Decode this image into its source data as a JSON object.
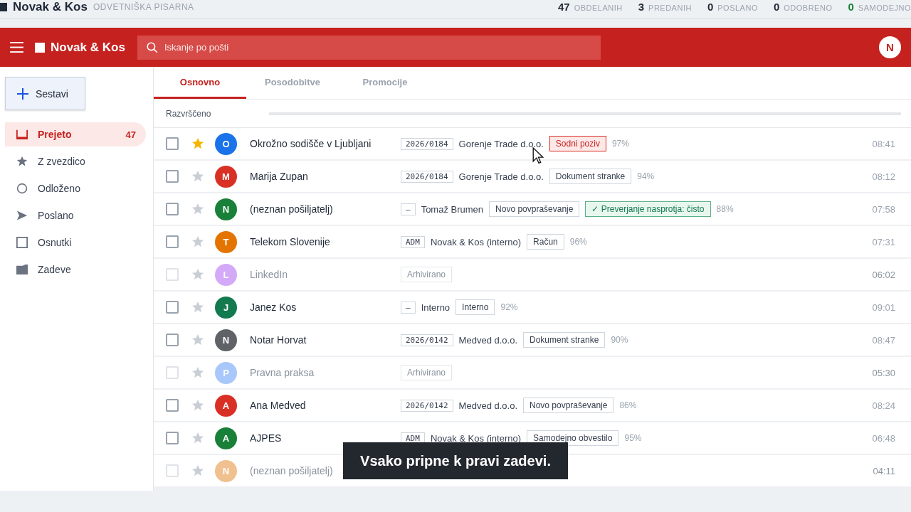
{
  "top_bar": {
    "brand": "Novak & Kos",
    "subtitle": "ODVETNIŠKA PISARNA",
    "stats": [
      {
        "value": "47",
        "label": "OBDELANIH",
        "color": "#1f2937"
      },
      {
        "value": "3",
        "label": "PREDANIH",
        "color": "#1f2937"
      },
      {
        "value": "0",
        "label": "POSLANO",
        "color": "#1f2937"
      },
      {
        "value": "0",
        "label": "ODOBRENO",
        "color": "#1f2937"
      },
      {
        "value": "0",
        "label": "SAMODEJNO",
        "color": "#188038"
      }
    ]
  },
  "header": {
    "title": "Novak & Kos",
    "search": {
      "placeholder": "Iskanje po pošti"
    },
    "avatar": "N"
  },
  "compose": "Sestavi",
  "sidebar": {
    "items": [
      {
        "kind": "inbox",
        "label": "Prejeto",
        "count": "47",
        "selected": true
      },
      {
        "kind": "star",
        "label": "Z zvezdico",
        "selected": false
      },
      {
        "kind": "clock",
        "label": "Odloženo",
        "selected": false
      },
      {
        "kind": "send",
        "label": "Poslano",
        "selected": false
      },
      {
        "kind": "draft",
        "label": "Osnutki",
        "selected": false
      },
      {
        "kind": "folder",
        "label": "Zadeve",
        "selected": false
      }
    ]
  },
  "tabs": [
    {
      "label": "Osnovno",
      "selected": true
    },
    {
      "label": "Posodobitve",
      "selected": false
    },
    {
      "label": "Promocije",
      "selected": false
    }
  ],
  "sort_label": "Razvrščeno",
  "rows": [
    {
      "initial": "O",
      "color": "#1a73e8",
      "sender": "Okrožno sodišče v Ljubljani",
      "starred": true,
      "archived": false,
      "ref": "2026/0184",
      "party": "Gorenje Trade d.o.o.",
      "tags": [
        {
          "text": "Sodni poziv",
          "kind": "alert"
        }
      ],
      "score": "97%",
      "time": "08:41"
    },
    {
      "initial": "M",
      "color": "#d93025",
      "sender": "Marija Zupan",
      "starred": false,
      "archived": false,
      "ref": "2026/0184",
      "party": "Gorenje Trade d.o.o.",
      "tags": [
        {
          "text": "Dokument stranke",
          "kind": "plain"
        }
      ],
      "score": "94%",
      "time": "08:12"
    },
    {
      "initial": "N",
      "color": "#188038",
      "sender": "(neznan pošiljatelj)",
      "starred": false,
      "archived": false,
      "ref": "–",
      "party": "Tomaž Brumen",
      "tags": [
        {
          "text": "Novo povpraševanje",
          "kind": "plain"
        },
        {
          "text": "✓ Preverjanje nasprotja: čisto",
          "kind": "check"
        }
      ],
      "score": "88%",
      "time": "07:58"
    },
    {
      "initial": "T",
      "color": "#e37400",
      "sender": "Telekom Slovenije",
      "starred": false,
      "archived": false,
      "ref": "ADM",
      "party": "Novak & Kos (interno)",
      "tags": [
        {
          "text": "Račun",
          "kind": "plain"
        }
      ],
      "score": "96%",
      "time": "07:31"
    },
    {
      "initial": "L",
      "color": "#d4a9f7",
      "sender": "LinkedIn",
      "starred": false,
      "archived": true,
      "tags": [
        {
          "text": "Arhivirano",
          "kind": "plain"
        }
      ],
      "time": "06:02"
    },
    {
      "initial": "J",
      "color": "#137a4f",
      "sender": "Janez Kos",
      "starred": false,
      "archived": false,
      "ref": "–",
      "party": "Interno",
      "tags": [
        {
          "text": "Interno",
          "kind": "plain"
        }
      ],
      "score": "92%",
      "time": "09:01"
    },
    {
      "initial": "N",
      "color": "#5f6368",
      "sender": "Notar Horvat",
      "starred": false,
      "archived": false,
      "ref": "2026/0142",
      "party": "Medved d.o.o.",
      "tags": [
        {
          "text": "Dokument stranke",
          "kind": "plain"
        }
      ],
      "score": "90%",
      "time": "08:47"
    },
    {
      "initial": "P",
      "color": "#a8c7fa",
      "sender": "Pravna praksa",
      "starred": false,
      "archived": true,
      "tags": [
        {
          "text": "Arhivirano",
          "kind": "plain"
        }
      ],
      "time": "05:30"
    },
    {
      "initial": "A",
      "color": "#d93025",
      "sender": "Ana Medved",
      "starred": false,
      "archived": false,
      "ref": "2026/0142",
      "party": "Medved d.o.o.",
      "tags": [
        {
          "text": "Novo povpraševanje",
          "kind": "plain"
        }
      ],
      "score": "86%",
      "time": "08:24"
    },
    {
      "initial": "A",
      "color": "#188038",
      "sender": "AJPES",
      "starred": false,
      "archived": false,
      "ref": "ADM",
      "party": "Novak & Kos (interno)",
      "tags": [
        {
          "text": "Samodejno obvestilo",
          "kind": "plain"
        }
      ],
      "score": "95%",
      "time": "06:48"
    },
    {
      "initial": "N",
      "color": "#f0c08f",
      "sender": "(neznan pošiljatelj)",
      "starred": false,
      "archived": true,
      "time": "04:11"
    }
  ],
  "caption": "Vsako pripne k pravi zadevi."
}
